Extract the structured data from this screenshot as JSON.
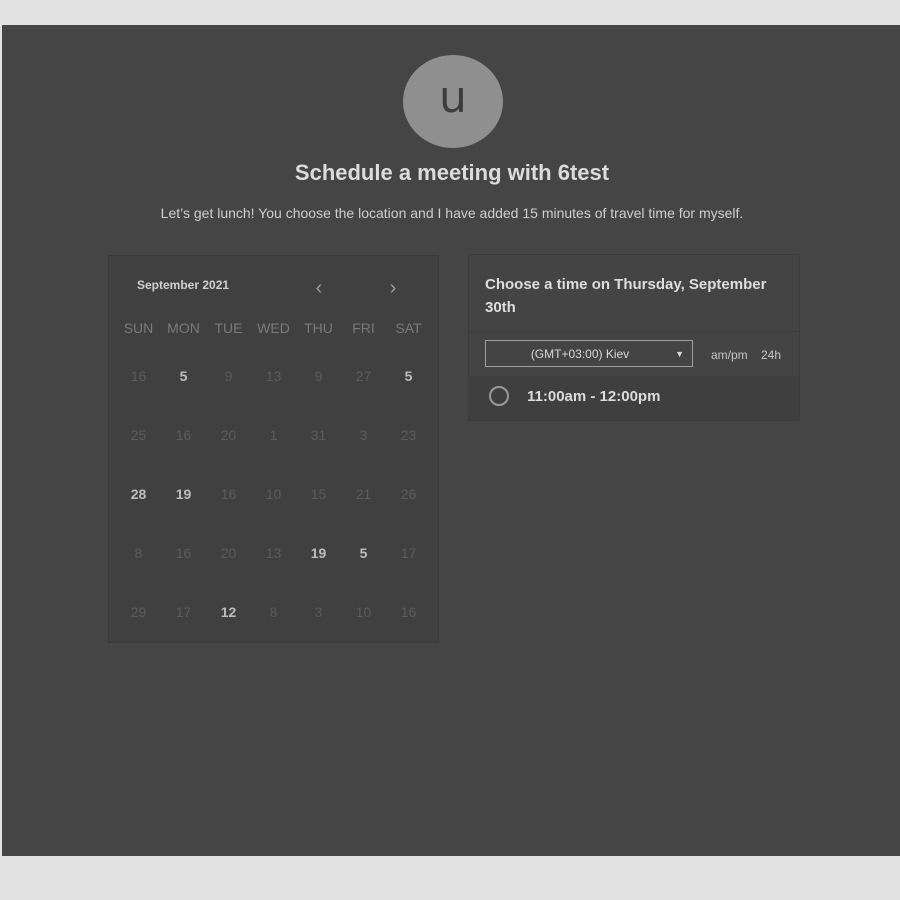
{
  "header": {
    "avatar_letter": "u",
    "title": "Schedule a meeting with 6test",
    "subtitle": "Let’s get lunch! You choose the location and I have added 15 minutes of travel time for myself."
  },
  "calendar": {
    "month_label": "September 2021",
    "prev_icon": "chevron-left-icon",
    "next_icon": "chevron-right-icon",
    "weekdays": [
      "SUN",
      "MON",
      "TUE",
      "WED",
      "THU",
      "FRI",
      "SAT"
    ],
    "rows": [
      [
        {
          "d": "16",
          "b": false
        },
        {
          "d": "5",
          "b": true
        },
        {
          "d": "9",
          "b": false
        },
        {
          "d": "13",
          "b": false
        },
        {
          "d": "9",
          "b": false
        },
        {
          "d": "27",
          "b": false
        },
        {
          "d": "5",
          "b": true
        }
      ],
      [
        {
          "d": "25",
          "b": false
        },
        {
          "d": "16",
          "b": false
        },
        {
          "d": "20",
          "b": false
        },
        {
          "d": "1",
          "b": false
        },
        {
          "d": "31",
          "b": false
        },
        {
          "d": "3",
          "b": false
        },
        {
          "d": "23",
          "b": false
        }
      ],
      [
        {
          "d": "28",
          "b": true
        },
        {
          "d": "19",
          "b": true
        },
        {
          "d": "16",
          "b": false
        },
        {
          "d": "10",
          "b": false
        },
        {
          "d": "15",
          "b": false
        },
        {
          "d": "21",
          "b": false
        },
        {
          "d": "26",
          "b": false
        }
      ],
      [
        {
          "d": "8",
          "b": false
        },
        {
          "d": "16",
          "b": false
        },
        {
          "d": "20",
          "b": false
        },
        {
          "d": "13",
          "b": false
        },
        {
          "d": "19",
          "b": true
        },
        {
          "d": "5",
          "b": true
        },
        {
          "d": "17",
          "b": false
        }
      ],
      [
        {
          "d": "29",
          "b": false
        },
        {
          "d": "17",
          "b": false
        },
        {
          "d": "12",
          "b": true
        },
        {
          "d": "8",
          "b": false
        },
        {
          "d": "3",
          "b": false
        },
        {
          "d": "10",
          "b": false
        },
        {
          "d": "16",
          "b": false
        }
      ]
    ]
  },
  "time_picker": {
    "heading": "Choose a time on Thursday, September 30th",
    "timezone": "(GMT+03:00) Kiev",
    "ampm_label": "am/pm",
    "h24_label": "24h",
    "slots": [
      "11:00am - 12:00pm"
    ]
  }
}
